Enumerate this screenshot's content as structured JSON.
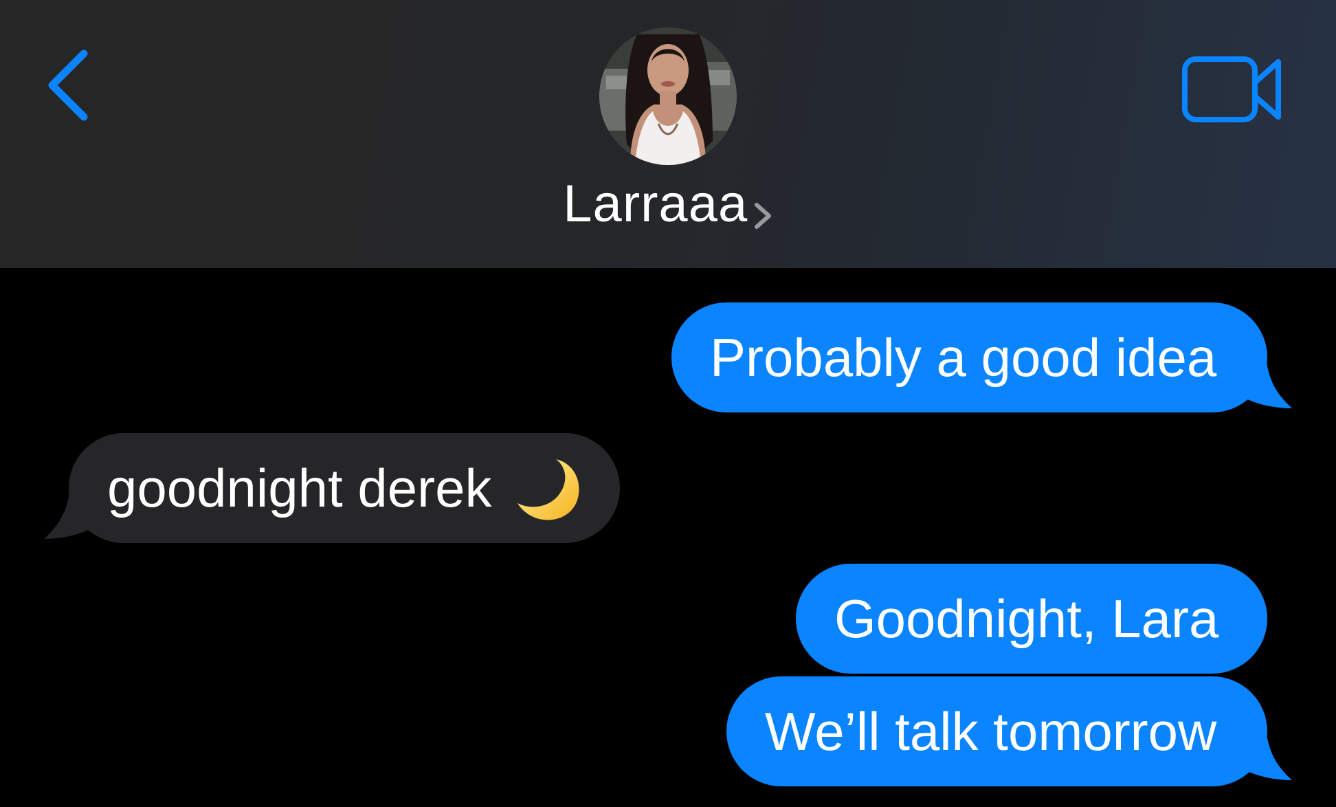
{
  "header": {
    "contact_name": "Larraaa",
    "accent_color": "#0a84ff",
    "icons": {
      "back": "chevron-left-icon",
      "video": "video-camera-icon",
      "disclosure": "chevron-right-icon"
    }
  },
  "messages": [
    {
      "direction": "outgoing",
      "text": "Probably a good idea"
    },
    {
      "direction": "incoming",
      "text": "goodnight derek",
      "emoji": "crescent-moon"
    },
    {
      "direction": "outgoing",
      "text": "Goodnight, Lara"
    },
    {
      "direction": "outgoing",
      "text": "We’ll talk tomorrow"
    }
  ],
  "colors": {
    "outgoing_bubble": "#0a84ff",
    "incoming_bubble": "#262629",
    "background": "#000000"
  }
}
